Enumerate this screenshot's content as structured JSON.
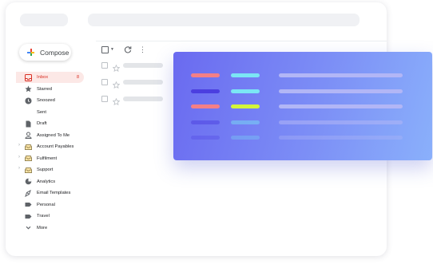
{
  "compose": {
    "label": "Compose"
  },
  "nav": [
    {
      "key": "inbox",
      "label": "Inbox",
      "icon": "inbox-icon",
      "count": "8",
      "active": true,
      "chevron": false
    },
    {
      "key": "starred",
      "label": "Starred",
      "icon": "star-icon",
      "count": "",
      "active": false,
      "chevron": false
    },
    {
      "key": "snoozed",
      "label": "Snoozed",
      "icon": "clock-icon",
      "count": "",
      "active": false,
      "chevron": false
    },
    {
      "key": "sent",
      "label": "Sent",
      "icon": "send-icon",
      "count": "",
      "active": false,
      "chevron": false
    },
    {
      "key": "draft",
      "label": "Draft",
      "icon": "draft-icon",
      "count": "",
      "active": false,
      "chevron": false
    },
    {
      "key": "assigned",
      "label": "Assigned To Me",
      "icon": "person-icon",
      "count": "",
      "active": false,
      "chevron": false
    },
    {
      "key": "account-payables",
      "label": "Account Payables",
      "icon": "shared-inbox-icon",
      "count": "",
      "active": false,
      "chevron": true
    },
    {
      "key": "fulfilment",
      "label": "Fulfilment",
      "icon": "shared-inbox-icon",
      "count": "",
      "active": false,
      "chevron": true
    },
    {
      "key": "support",
      "label": "Support",
      "icon": "shared-inbox-icon",
      "count": "",
      "active": false,
      "chevron": true
    },
    {
      "key": "analytics",
      "label": "Analytics",
      "icon": "analytics-icon",
      "count": "",
      "active": false,
      "chevron": false
    },
    {
      "key": "email-templates",
      "label": "Email Templates",
      "icon": "template-icon",
      "count": "",
      "active": false,
      "chevron": false
    },
    {
      "key": "personal",
      "label": "Personal",
      "icon": "label-icon",
      "count": "",
      "active": false,
      "chevron": false
    },
    {
      "key": "travel",
      "label": "Travel",
      "icon": "label-icon",
      "count": "",
      "active": false,
      "chevron": false
    },
    {
      "key": "more",
      "label": "More",
      "icon": "chevron-down-icon",
      "count": "",
      "active": false,
      "chevron": false
    }
  ],
  "toolbar": {
    "select_icon": "checkbox-icon",
    "refresh_icon": "refresh-icon",
    "more_icon": "more-vert-icon"
  },
  "mail_rows": 3,
  "colors": {
    "accent": "#d93025",
    "active_bg": "#fce8e6",
    "card_from": "#6a6af0",
    "card_to": "#8ab0fb",
    "red_pill": "#f47f86",
    "indigo_pill": "#4b3fe0",
    "cyan_pill": "#7be6f5",
    "lime_pill": "#d4f53a",
    "faint_pill": "#b2b6f6"
  }
}
